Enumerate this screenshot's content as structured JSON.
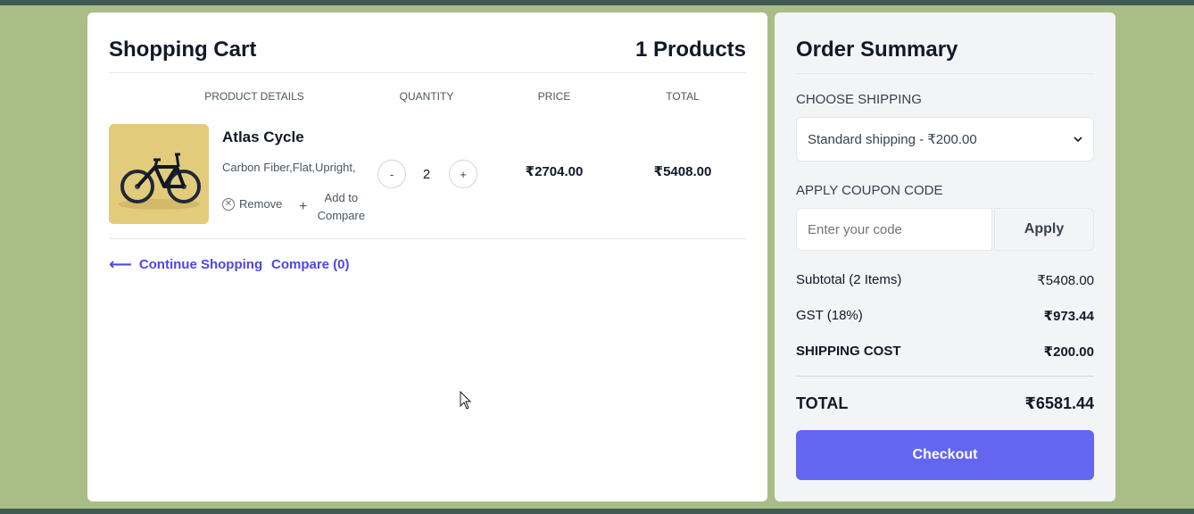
{
  "cart": {
    "title": "Shopping Cart",
    "count_label": "1 Products",
    "columns": {
      "product": "PRODUCT DETAILS",
      "quantity": "QUANTITY",
      "price": "PRICE",
      "total": "TOTAL"
    },
    "items": [
      {
        "name": "Atlas Cycle",
        "description": "Carbon Fiber,Flat,Upright,",
        "remove_label": "Remove",
        "compare_label": "Add to Compare",
        "quantity": "2",
        "minus_label": "-",
        "plus_label": "+",
        "price": "₹2704.00",
        "total": "₹5408.00"
      }
    ],
    "continue_label": "Continue Shopping",
    "compare_link": "Compare (0)"
  },
  "summary": {
    "title": "Order Summary",
    "shipping_label": "CHOOSE SHIPPING",
    "shipping_selected": "Standard shipping - ₹200.00",
    "coupon_label": "APPLY COUPON CODE",
    "coupon_placeholder": "Enter your code",
    "apply_label": "Apply",
    "subtotal_label": "Subtotal (2 Items)",
    "subtotal_value": "₹5408.00",
    "gst_label": "GST (18%)",
    "gst_value": "₹973.44",
    "shipping_cost_label": "SHIPPING COST",
    "shipping_cost_value": "₹200.00",
    "total_label": "TOTAL",
    "total_value": "₹6581.44",
    "checkout_label": "Checkout"
  },
  "colors": {
    "accent": "#6366f1",
    "link": "#4f46e5",
    "background": "#a9bd86"
  },
  "icons": [
    "remove-circle-x-icon",
    "plus-icon",
    "arrow-left-icon",
    "chevron-down-icon",
    "mouse-cursor-icon"
  ]
}
